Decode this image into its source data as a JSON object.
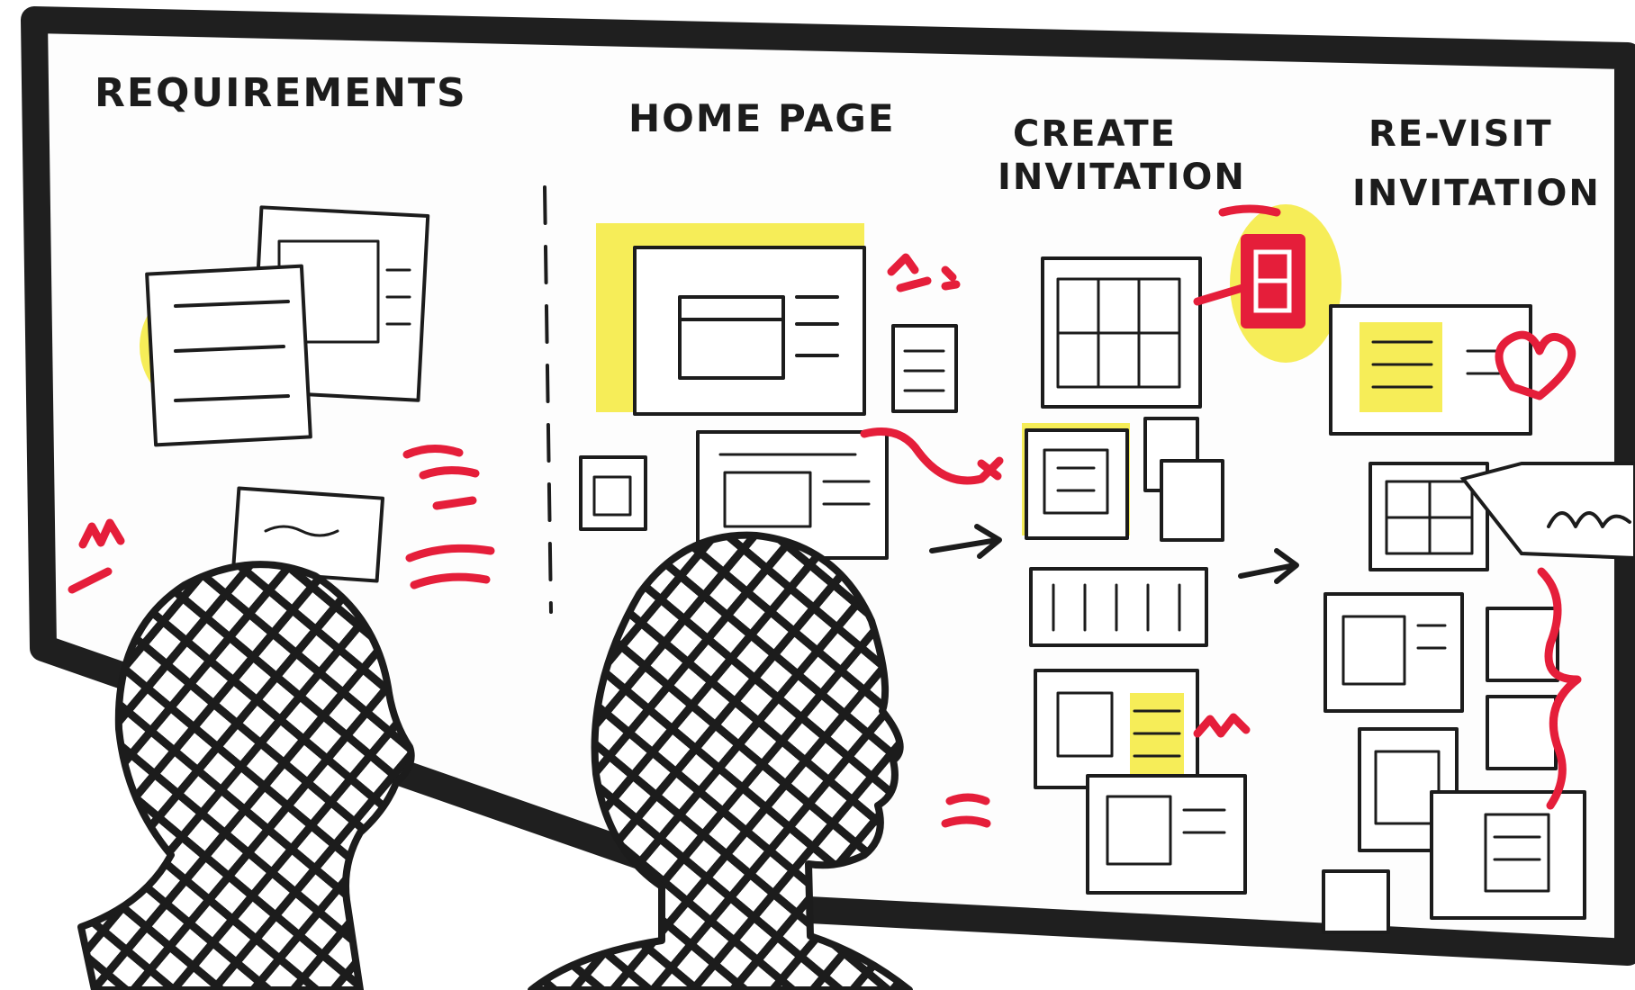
{
  "board": {
    "sections": [
      {
        "id": "requirements",
        "label": "REQUIREMENTS"
      },
      {
        "id": "home-page",
        "label": "HOME PAGE"
      },
      {
        "id": "create-invitation",
        "label_lines": [
          "CREATE",
          "INVITATION"
        ]
      },
      {
        "id": "revisit-invitation",
        "label_lines": [
          "RE-VISIT",
          "INVITATION"
        ]
      }
    ]
  },
  "colors": {
    "ink": "#1c1c1c",
    "highlight": "#f5ea3b",
    "annotation_red": "#e51e3a",
    "paper": "#ffffff"
  },
  "figures": [
    {
      "name": "person-left",
      "style": "crosshatched silhouette"
    },
    {
      "name": "person-center",
      "style": "crosshatched silhouette"
    }
  ]
}
